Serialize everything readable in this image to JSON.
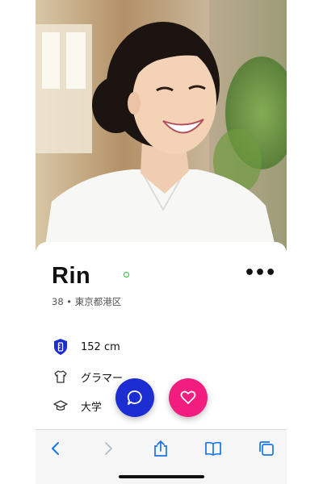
{
  "profile": {
    "name": "Rin",
    "meta": "38 • 東京都港区",
    "online": true,
    "attributes": [
      {
        "icon": "ruler-badge-icon",
        "label": "152 cm"
      },
      {
        "icon": "shirt-icon",
        "label": "グラマー"
      },
      {
        "icon": "graduation-cap-icon",
        "label": "大学"
      }
    ]
  },
  "actions": {
    "more_label": "•••",
    "chat_icon": "chat-bubble-icon",
    "like_icon": "heart-icon"
  },
  "browser_toolbar": {
    "items": [
      "back-icon",
      "forward-icon",
      "share-icon",
      "bookmarks-icon",
      "tabs-icon"
    ]
  },
  "colors": {
    "chat_button": "#1c2ed1",
    "like_button": "#f21d7f",
    "online_dot": "#1fc42c",
    "toolbar_accent": "#1a73e8"
  }
}
